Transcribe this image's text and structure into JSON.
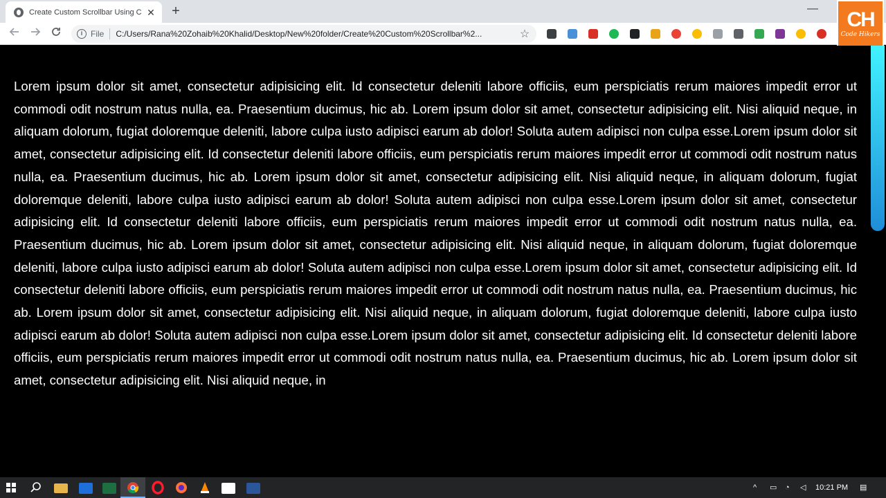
{
  "browser": {
    "tab_title": "Create Custom Scrollbar Using C",
    "tab_close": "✕",
    "new_tab": "+",
    "minimize": "—",
    "file_label": "File",
    "url": "C:/Users/Rana%20Zohaib%20Khalid/Desktop/New%20folder/Create%20Custom%20Scrollbar%2..."
  },
  "logo": {
    "mark": "CH",
    "sub": "Code Hikers"
  },
  "page": {
    "text": "Lorem ipsum dolor sit amet, consectetur adipisicing elit. Id consectetur deleniti labore officiis, eum perspiciatis rerum maiores impedit error ut commodi odit nostrum natus nulla, ea. Praesentium ducimus, hic ab. Lorem ipsum dolor sit amet, consectetur adipisicing elit. Nisi aliquid neque, in aliquam dolorum, fugiat doloremque deleniti, labore culpa iusto adipisci earum ab dolor! Soluta autem adipisci non culpa esse.Lorem ipsum dolor sit amet, consectetur adipisicing elit. Id consectetur deleniti labore officiis, eum perspiciatis rerum maiores impedit error ut commodi odit nostrum natus nulla, ea. Praesentium ducimus, hic ab. Lorem ipsum dolor sit amet, consectetur adipisicing elit. Nisi aliquid neque, in aliquam dolorum, fugiat doloremque deleniti, labore culpa iusto adipisci earum ab dolor! Soluta autem adipisci non culpa esse.Lorem ipsum dolor sit amet, consectetur adipisicing elit. Id consectetur deleniti labore officiis, eum perspiciatis rerum maiores impedit error ut commodi odit nostrum natus nulla, ea. Praesentium ducimus, hic ab. Lorem ipsum dolor sit amet, consectetur adipisicing elit. Nisi aliquid neque, in aliquam dolorum, fugiat doloremque deleniti, labore culpa iusto adipisci earum ab dolor! Soluta autem adipisci non culpa esse.Lorem ipsum dolor sit amet, consectetur adipisicing elit. Id consectetur deleniti labore officiis, eum perspiciatis rerum maiores impedit error ut commodi odit nostrum natus nulla, ea. Praesentium ducimus, hic ab. Lorem ipsum dolor sit amet, consectetur adipisicing elit. Nisi aliquid neque, in aliquam dolorum, fugiat doloremque deleniti, labore culpa iusto adipisci earum ab dolor! Soluta autem adipisci non culpa esse.Lorem ipsum dolor sit amet, consectetur adipisicing elit. Id consectetur deleniti labore officiis, eum perspiciatis rerum maiores impedit error ut commodi odit nostrum natus nulla, ea. Praesentium ducimus, hic ab. Lorem ipsum dolor sit amet, consectetur adipisicing elit. Nisi aliquid neque, in"
  },
  "scrollbar": {
    "thumb_color_top": "#41f3ff",
    "thumb_color_bottom": "#1f8dd8"
  },
  "taskbar": {
    "clock": "10:21 PM"
  }
}
